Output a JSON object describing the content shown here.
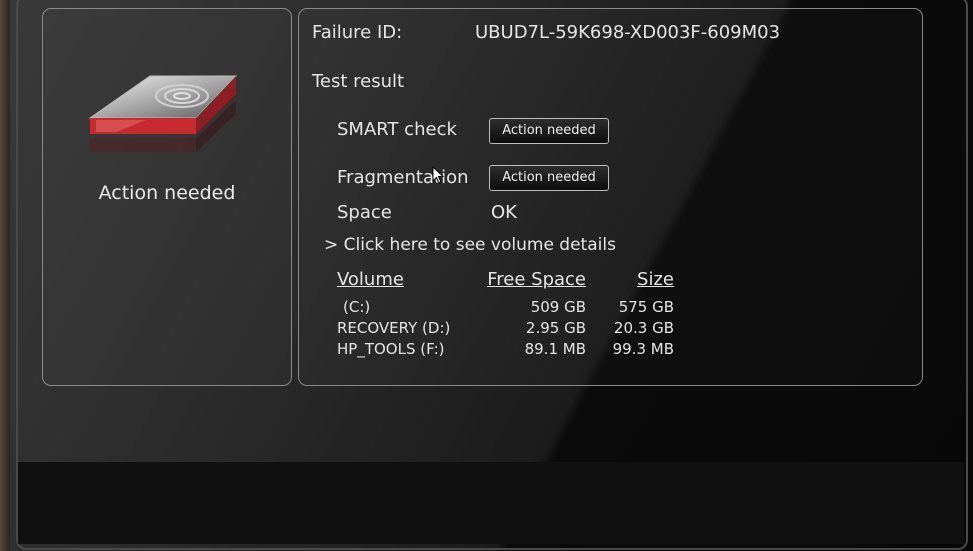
{
  "summary": {
    "status_label": "Action needed"
  },
  "details": {
    "failure_id_label": "Failure ID:",
    "failure_id_value": "UBUD7L-59K698-XD003F-609M03",
    "test_result_heading": "Test result",
    "tests": [
      {
        "label": "SMART check",
        "result": "Action needed",
        "result_type": "button"
      },
      {
        "label": "Fragmentation",
        "result": "Action needed",
        "result_type": "button"
      },
      {
        "label": "Space",
        "result": "OK",
        "result_type": "text"
      }
    ],
    "volume_details_link": "> Click here to see volume details",
    "volume_table": {
      "headers": [
        "Volume",
        "Free Space",
        "Size"
      ],
      "rows": [
        [
          "(C:)",
          "509 GB",
          "575 GB"
        ],
        [
          "RECOVERY (D:)",
          "2.95 GB",
          "20.3 GB"
        ],
        [
          "HP_TOOLS (F:)",
          "89.1 MB",
          "99.3 MB"
        ]
      ]
    }
  },
  "colors": {
    "alert_red": "#d0242b",
    "border": "#8a8a8a"
  },
  "icons": {
    "drive": "hard-drive-icon",
    "cursor": "mouse-pointer-icon"
  }
}
